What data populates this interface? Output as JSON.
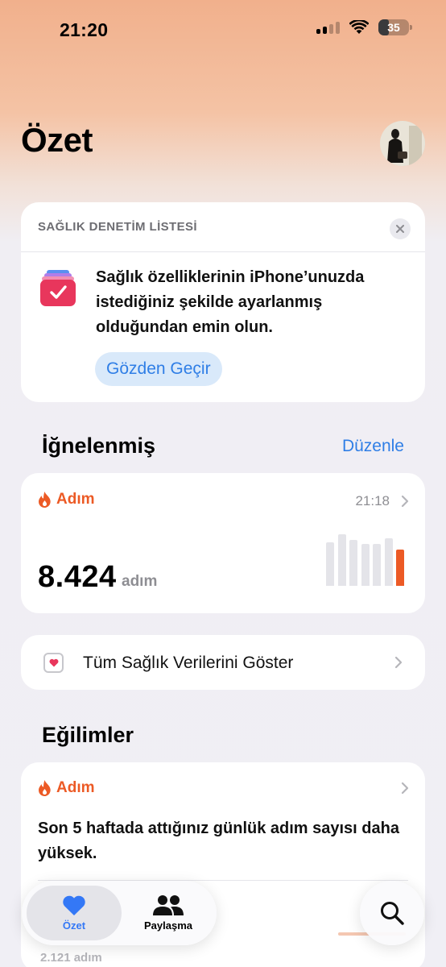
{
  "status_bar": {
    "time": "21:20",
    "battery": "35",
    "battery_level": 0.35
  },
  "header": {
    "title": "Özet",
    "avatar": "profile-photo"
  },
  "checklist": {
    "label": "SAĞLIK DENETİM LİSTESİ",
    "message": "Sağlık özelliklerinin iPhone’unuzda istediğiniz şekilde ayarlanmış olduğundan emin olun.",
    "button": "Gözden Geçir"
  },
  "pinned": {
    "title": "İğnelenmiş",
    "edit": "Düzenle",
    "steps": {
      "name": "Adım",
      "time": "21:18",
      "value": "8.424",
      "unit": "adım",
      "week_levels": [
        0.82,
        0.97,
        0.86,
        0.79,
        0.79,
        0.89,
        0.68
      ]
    },
    "show_all": "Tüm Sağlık Verilerini Göster"
  },
  "trends": {
    "title": "Eğilimler",
    "metric": "Adım",
    "message": "Son 5 haftada attığınız günlük adım sayısı daha yüksek.",
    "footer": "2.121 adım"
  },
  "tabbar": {
    "summary": "Özet",
    "sharing": "Paylaşma"
  },
  "colors": {
    "accent": "#ec5a25",
    "link": "#2f7ee6",
    "heart_tab": "#3478f6"
  }
}
